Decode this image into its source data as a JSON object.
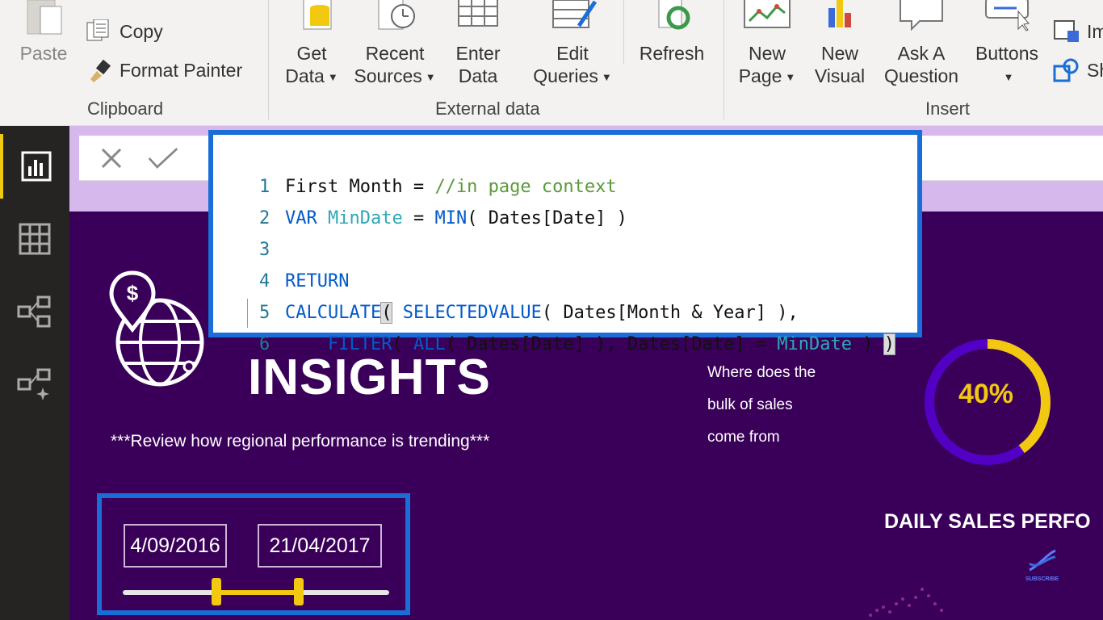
{
  "ribbon": {
    "clipboard": {
      "paste": "Paste",
      "copy": "Copy",
      "format_painter": "Format Painter",
      "group": "Clipboard"
    },
    "external_data": {
      "get_data": [
        "Get",
        "Data"
      ],
      "recent_sources": [
        "Recent",
        "Sources"
      ],
      "enter_data": [
        "Enter",
        "Data"
      ],
      "edit_queries": [
        "Edit",
        "Queries"
      ],
      "refresh": "Refresh",
      "group": "External data"
    },
    "insert": {
      "new_page": [
        "New",
        "Page"
      ],
      "new_visual": [
        "New",
        "Visual"
      ],
      "ask_question": [
        "Ask A",
        "Question"
      ],
      "buttons": "Buttons",
      "image_partial": "Im",
      "shapes_partial": "Sh",
      "group": "Insert"
    }
  },
  "formula": {
    "lines": [
      {
        "num": "1"
      },
      {
        "num": "2"
      },
      {
        "num": "3"
      },
      {
        "num": "4"
      },
      {
        "num": "5"
      },
      {
        "num": "6"
      }
    ],
    "tokens": {
      "l1_name": "First Month",
      "l1_eq": " = ",
      "l1_comment": "//in page context",
      "l2_var": "VAR",
      "l2_name": "MinDate",
      "l2_eq": " = ",
      "l2_fn": "MIN",
      "l2_rest": "( Dates[Date] )",
      "l4_return": "RETURN",
      "l5_calc": "CALCULATE",
      "l5_paren": "(",
      "l5_sv": "SELECTEDVALUE",
      "l5_rest": "( Dates[Month & Year] ),",
      "l6_filter": "FILTER",
      "l6_p1": "( ",
      "l6_all": "ALL",
      "l6_p2": "( Dates[Date] ), Dates[Date] = ",
      "l6_var": "MinDate",
      "l6_p3": " ) ",
      "l6_close": ")"
    }
  },
  "report": {
    "title": "INSIGHTS",
    "subtitle": "***Review how regional performance is trending***",
    "question": [
      "Where does the",
      "bulk of sales",
      "come from"
    ],
    "donut_label": "40%",
    "donut_value": 0.4,
    "daily_title": "DAILY SALES PERFO",
    "date_start": "4/09/2016",
    "date_end": "21/04/2017",
    "slider_start": 0.35,
    "slider_end": 0.66,
    "subscribe": "SUBSCRIBE"
  },
  "colors": {
    "accent": "#f2c811",
    "canvas": "#3a0059",
    "highlight_border": "#1a6ed8",
    "formula_band": "#d7b8ec"
  }
}
